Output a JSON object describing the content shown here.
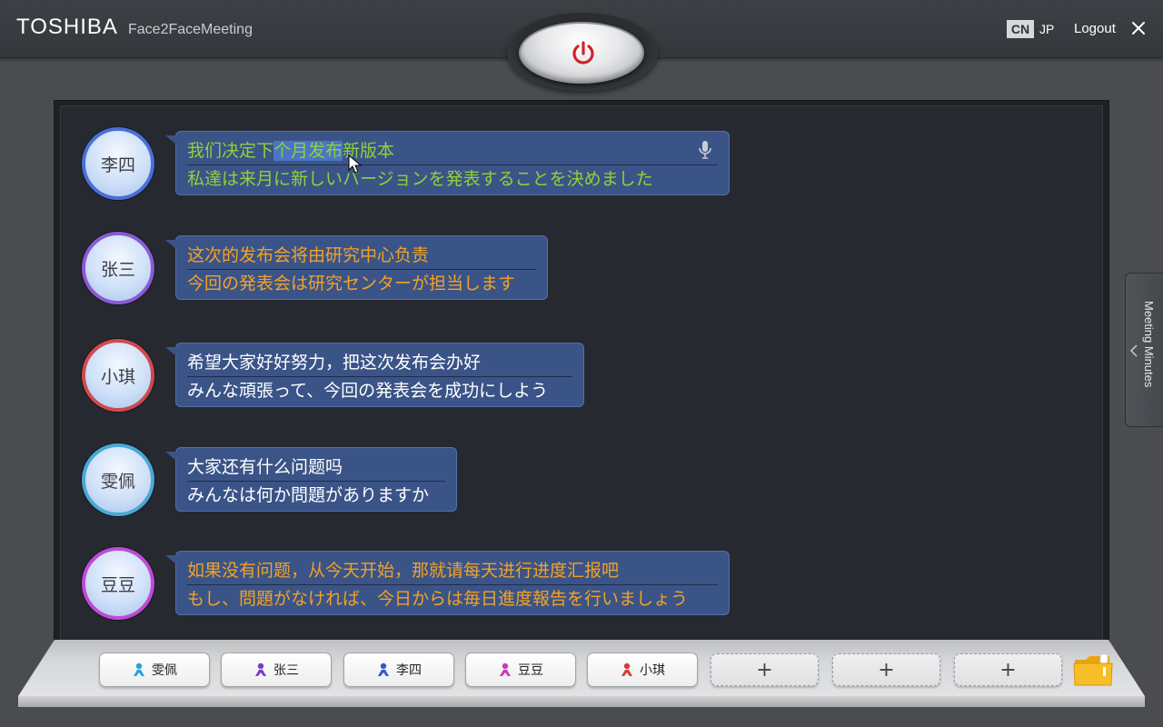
{
  "header": {
    "brand": "TOSHIBA",
    "app_name": "Face2FaceMeeting",
    "lang_cn": "CN",
    "lang_jp": "JP",
    "logout": "Logout",
    "close_icon": "close-icon",
    "power_icon": "power-icon"
  },
  "messages": [
    {
      "speaker": "李四",
      "text_cn_before": "我们决定下",
      "text_cn_highlight": "个月发布",
      "text_cn_after": "新版本",
      "text_jp": "私達は来月に新しいバージョンを発表することを決めました",
      "color": "#8fd13a",
      "ring": "#4a6fd8",
      "has_mic": true
    },
    {
      "speaker": "张三",
      "text_cn": "这次的发布会将由研究中心负责",
      "text_jp": "今回の発表会は研究センターが担当します",
      "color": "#f2a227",
      "ring": "#8a5ad6"
    },
    {
      "speaker": "小琪",
      "text_cn": "希望大家好好努力，把这次发布会办好",
      "text_jp": "みんな頑張って、今回の発表会を成功にしよう",
      "color": "#ffffff",
      "ring": "#d04a4f"
    },
    {
      "speaker": "雯佩",
      "text_cn": "大家还有什么问题吗",
      "text_jp": "みんなは何か問題がありますか",
      "color": "#ffffff",
      "ring": "#4aa8d6"
    },
    {
      "speaker": "豆豆",
      "text_cn": "如果没有问题，从今天开始，那就请每天进行进度汇报吧",
      "text_jp": "もし、問題がなければ、今日からは毎日進度報告を行いましょう",
      "color": "#f2a227",
      "ring": "#c04ad6"
    }
  ],
  "side_tab": {
    "label": "Meeting Minutes",
    "icon": "chevron-left-icon"
  },
  "participants": [
    {
      "name": "雯佩",
      "color": "#2a9fd8"
    },
    {
      "name": "张三",
      "color": "#7a3cc8"
    },
    {
      "name": "李四",
      "color": "#3a56c8"
    },
    {
      "name": "豆豆",
      "color": "#c83ab8"
    },
    {
      "name": "小琪",
      "color": "#d83a3a"
    }
  ],
  "add_participant_label": "+",
  "folder_icon": "folder-icon"
}
